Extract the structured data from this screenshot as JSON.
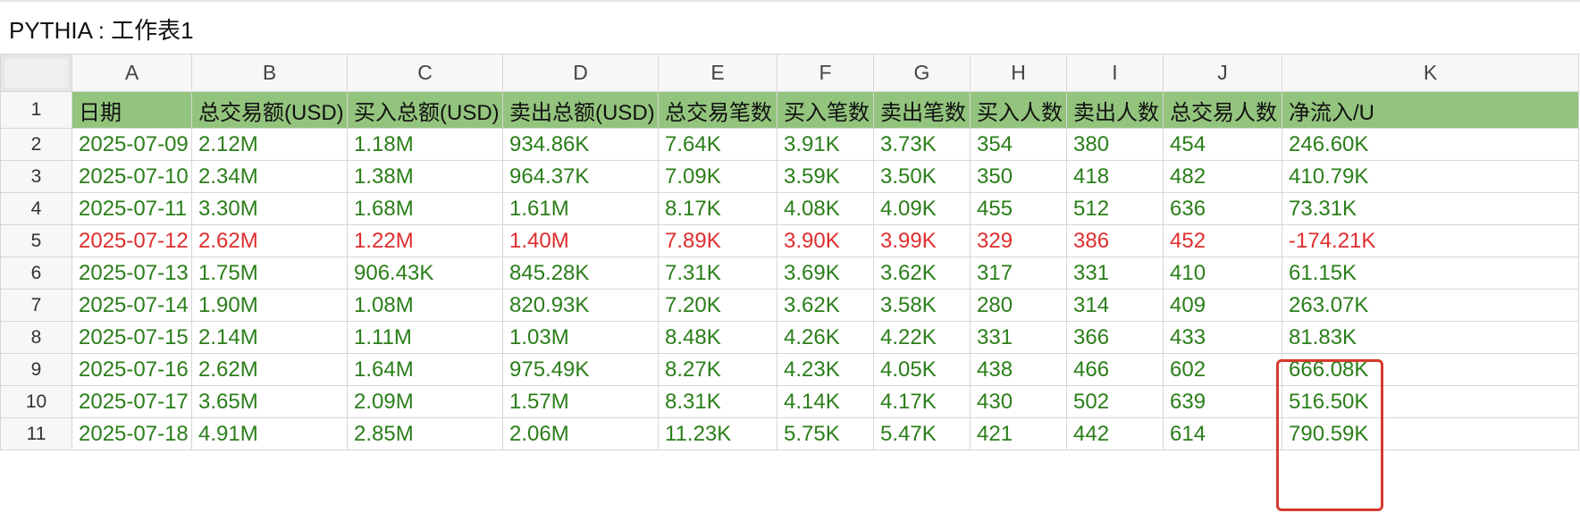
{
  "window": {
    "title": "PYTHIA : 工作表1"
  },
  "columns": [
    "A",
    "B",
    "C",
    "D",
    "E",
    "F",
    "G",
    "H",
    "I",
    "J",
    "K"
  ],
  "header_row": {
    "row_number": "1",
    "cells": [
      "日期",
      "总交易额(USD)",
      "买入总额(USD)",
      "卖出总额(USD)",
      "总交易笔数",
      "买入笔数",
      "卖出笔数",
      "买入人数",
      "卖出人数",
      "总交易人数",
      "净流入/U"
    ]
  },
  "rows": [
    {
      "row_number": "2",
      "negative": false,
      "cells": [
        "2025-07-09",
        "2.12M",
        "1.18M",
        "934.86K",
        "7.64K",
        "3.91K",
        "3.73K",
        "354",
        "380",
        "454",
        "246.60K"
      ]
    },
    {
      "row_number": "3",
      "negative": false,
      "cells": [
        "2025-07-10",
        "2.34M",
        "1.38M",
        "964.37K",
        "7.09K",
        "3.59K",
        "3.50K",
        "350",
        "418",
        "482",
        "410.79K"
      ]
    },
    {
      "row_number": "4",
      "negative": false,
      "cells": [
        "2025-07-11",
        "3.30M",
        "1.68M",
        "1.61M",
        "8.17K",
        "4.08K",
        "4.09K",
        "455",
        "512",
        "636",
        "73.31K"
      ]
    },
    {
      "row_number": "5",
      "negative": true,
      "cells": [
        "2025-07-12",
        "2.62M",
        "1.22M",
        "1.40M",
        "7.89K",
        "3.90K",
        "3.99K",
        "329",
        "386",
        "452",
        "-174.21K"
      ]
    },
    {
      "row_number": "6",
      "negative": false,
      "cells": [
        "2025-07-13",
        "1.75M",
        "906.43K",
        "845.28K",
        "7.31K",
        "3.69K",
        "3.62K",
        "317",
        "331",
        "410",
        "61.15K"
      ]
    },
    {
      "row_number": "7",
      "negative": false,
      "cells": [
        "2025-07-14",
        "1.90M",
        "1.08M",
        "820.93K",
        "7.20K",
        "3.62K",
        "3.58K",
        "280",
        "314",
        "409",
        "263.07K"
      ]
    },
    {
      "row_number": "8",
      "negative": false,
      "cells": [
        "2025-07-15",
        "2.14M",
        "1.11M",
        "1.03M",
        "8.48K",
        "4.26K",
        "4.22K",
        "331",
        "366",
        "433",
        "81.83K"
      ]
    },
    {
      "row_number": "9",
      "negative": false,
      "cells": [
        "2025-07-16",
        "2.62M",
        "1.64M",
        "975.49K",
        "8.27K",
        "4.23K",
        "4.05K",
        "438",
        "466",
        "602",
        "666.08K"
      ]
    },
    {
      "row_number": "10",
      "negative": false,
      "cells": [
        "2025-07-17",
        "3.65M",
        "2.09M",
        "1.57M",
        "8.31K",
        "4.14K",
        "4.17K",
        "430",
        "502",
        "639",
        "516.50K"
      ]
    },
    {
      "row_number": "11",
      "negative": false,
      "cells": [
        "2025-07-18",
        "4.91M",
        "2.85M",
        "2.06M",
        "11.23K",
        "5.75K",
        "5.47K",
        "421",
        "442",
        "614",
        "790.59K"
      ]
    }
  ],
  "colors": {
    "header_fill": "#93c47d",
    "positive_text": "#2a7e19",
    "negative_text": "#e02d2d",
    "annotation_box": "#d63a2e"
  }
}
